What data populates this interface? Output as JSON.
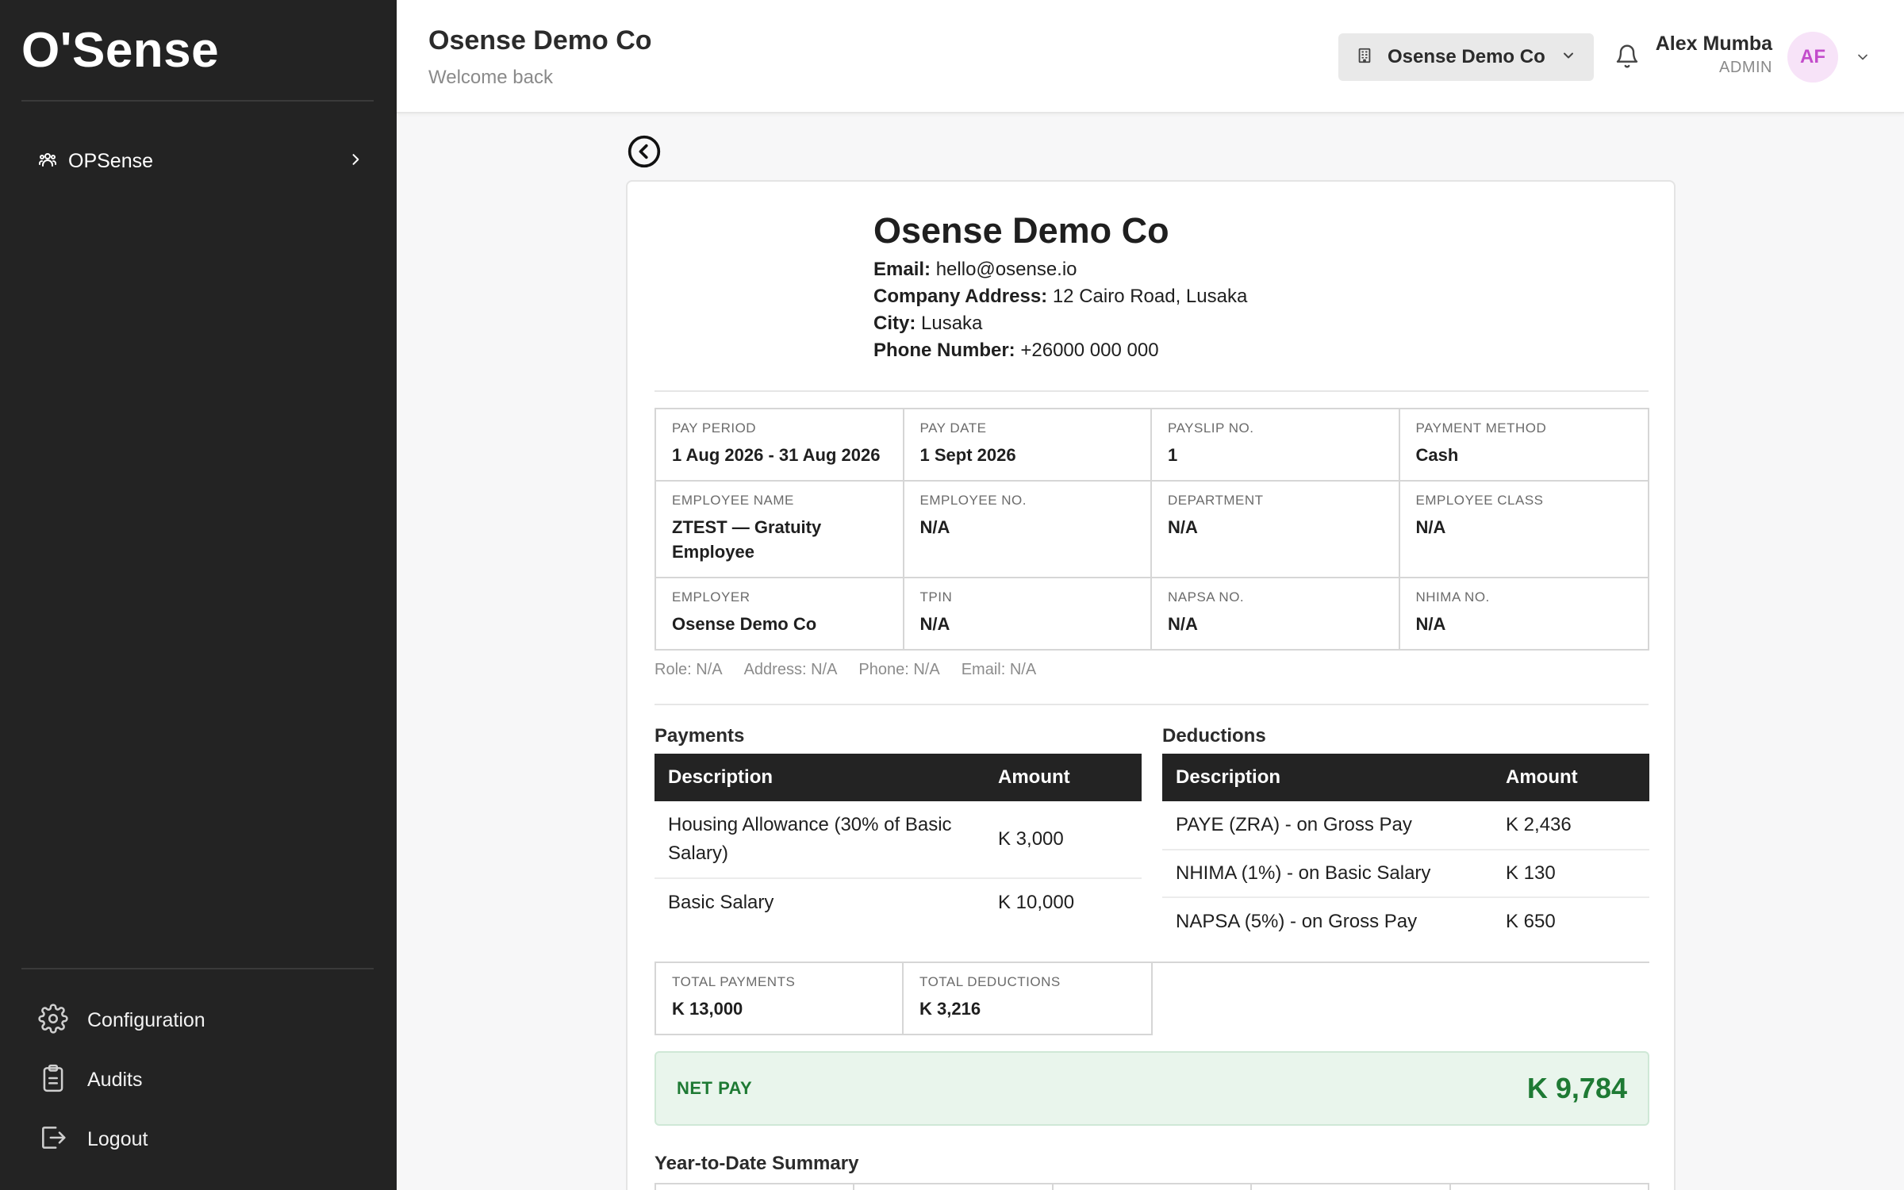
{
  "sidebar": {
    "logo": "O'Sense",
    "top_item": {
      "label": "OPSense",
      "icon": "users-icon"
    },
    "bottom_items": [
      {
        "label": "Configuration",
        "icon": "gear-icon"
      },
      {
        "label": "Audits",
        "icon": "clipboard-icon"
      },
      {
        "label": "Logout",
        "icon": "logout-icon"
      }
    ]
  },
  "header": {
    "title": "Osense Demo Co",
    "subtitle": "Welcome back",
    "org_selector": "Osense Demo Co",
    "user": {
      "name": "Alex Mumba",
      "role": "ADMIN",
      "initials": "AF"
    }
  },
  "company": {
    "name": "Osense Demo Co",
    "email_label": "Email:",
    "email": "hello@osense.io",
    "address_label": "Company Address:",
    "address": "12 Cairo Road, Lusaka",
    "city_label": "City:",
    "city": "Lusaka",
    "phone_label": "Phone Number:",
    "phone": "+26000 000 000"
  },
  "info": {
    "rows": [
      [
        {
          "label": "PAY PERIOD",
          "value": "1 Aug 2026 - 31 Aug 2026"
        },
        {
          "label": "PAY DATE",
          "value": "1 Sept 2026"
        },
        {
          "label": "PAYSLIP NO.",
          "value": "1"
        },
        {
          "label": "PAYMENT METHOD",
          "value": "Cash"
        }
      ],
      [
        {
          "label": "EMPLOYEE NAME",
          "value": "ZTEST — Gratuity Employee"
        },
        {
          "label": "EMPLOYEE NO.",
          "value": "N/A"
        },
        {
          "label": "DEPARTMENT",
          "value": "N/A"
        },
        {
          "label": "EMPLOYEE CLASS",
          "value": "N/A"
        }
      ],
      [
        {
          "label": "EMPLOYER",
          "value": "Osense Demo Co"
        },
        {
          "label": "TPIN",
          "value": "N/A"
        },
        {
          "label": "NAPSA NO.",
          "value": "N/A"
        },
        {
          "label": "NHIMA NO.",
          "value": "N/A"
        }
      ]
    ],
    "meta": [
      "Role: N/A",
      "Address: N/A",
      "Phone: N/A",
      "Email: N/A"
    ]
  },
  "payments": {
    "title": "Payments",
    "col_desc": "Description",
    "col_amount": "Amount",
    "rows": [
      {
        "description": "Housing Allowance (30% of Basic Salary)",
        "amount": "K 3,000"
      },
      {
        "description": "Basic Salary",
        "amount": "K 10,000"
      }
    ]
  },
  "deductions": {
    "title": "Deductions",
    "col_desc": "Description",
    "col_amount": "Amount",
    "rows": [
      {
        "description": "PAYE (ZRA) - on Gross Pay",
        "amount": "K 2,436"
      },
      {
        "description": "NHIMA (1%) - on Basic Salary",
        "amount": "K 130"
      },
      {
        "description": "NAPSA (5%) - on Gross Pay",
        "amount": "K 650"
      }
    ]
  },
  "totals": {
    "payments_label": "TOTAL PAYMENTS",
    "payments_value": "K 13,000",
    "deductions_label": "TOTAL DEDUCTIONS",
    "deductions_value": "K 3,216"
  },
  "net_pay": {
    "label": "NET PAY",
    "value": "K 9,784"
  },
  "ytd": {
    "title": "Year-to-Date Summary"
  },
  "colors": {
    "sidebar": "#232323",
    "accent_green": "#1e7a34",
    "avatar_bg": "#f7e3f8",
    "avatar_text": "#c34ccb"
  }
}
